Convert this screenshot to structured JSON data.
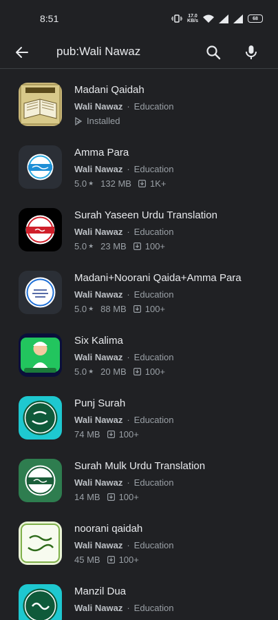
{
  "status": {
    "time": "8:51",
    "net_speed_value": "17.0",
    "net_speed_unit": "KB/s",
    "battery": "68"
  },
  "search": {
    "query": "pub:Wali Nawaz"
  },
  "apps": [
    {
      "title": "Madani Qaidah",
      "developer": "Wali Nawaz",
      "category": "Education",
      "status": "Installed",
      "icon": "quran-book-icon"
    },
    {
      "title": "Amma Para",
      "developer": "Wali Nawaz",
      "category": "Education",
      "rating": "5.0",
      "size": "132 MB",
      "downloads": "1K+",
      "icon": "amma-para-icon"
    },
    {
      "title": "Surah Yaseen Urdu Translation",
      "developer": "Wali Nawaz",
      "category": "Education",
      "rating": "5.0",
      "size": "23 MB",
      "downloads": "100+",
      "icon": "surah-yaseen-icon"
    },
    {
      "title": "Madani+Noorani Qaida+Amma Para",
      "developer": "Wali Nawaz",
      "category": "Education",
      "rating": "5.0",
      "size": "88 MB",
      "downloads": "100+",
      "icon": "noorani-qaida-icon"
    },
    {
      "title": "Six Kalima",
      "developer": "Wali Nawaz",
      "category": "Education",
      "rating": "5.0",
      "size": "20 MB",
      "downloads": "100+",
      "icon": "six-kalima-icon"
    },
    {
      "title": "Punj Surah",
      "developer": "Wali Nawaz",
      "category": "Education",
      "size": "74 MB",
      "downloads": "100+",
      "icon": "punj-surah-icon"
    },
    {
      "title": "Surah Mulk Urdu Translation",
      "developer": "Wali Nawaz",
      "category": "Education",
      "size": "14 MB",
      "downloads": "100+",
      "icon": "surah-mulk-icon"
    },
    {
      "title": "noorani qaidah",
      "developer": "Wali Nawaz",
      "category": "Education",
      "size": "45 MB",
      "downloads": "100+",
      "icon": "noorani-qaidah-icon"
    },
    {
      "title": "Manzil Dua",
      "developer": "Wali Nawaz",
      "category": "Education",
      "icon": "manzil-dua-icon"
    }
  ],
  "symbols": {
    "dot": "·",
    "star": "★"
  }
}
